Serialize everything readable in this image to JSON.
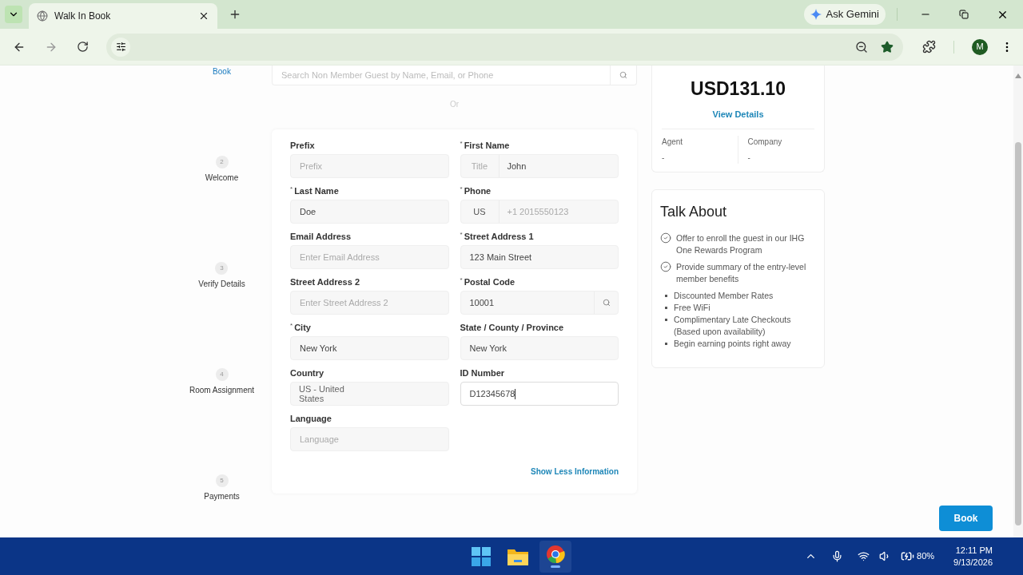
{
  "browser": {
    "tab_title": "Walk In Book",
    "ask_gemini": "Ask Gemini",
    "avatar": "M"
  },
  "steps": [
    {
      "label": "Book",
      "current": true
    },
    {
      "number": "2",
      "label": "Welcome",
      "current": false
    },
    {
      "number": "3",
      "label": "Verify Details",
      "current": false
    },
    {
      "number": "4",
      "label": "Room Assignment",
      "current": false
    },
    {
      "number": "5",
      "label": "Payments",
      "current": false
    }
  ],
  "search": {
    "placeholder": "Search Non Member Guest by Name, Email, or Phone"
  },
  "or_text": "Or",
  "fields": [
    {
      "label": "Prefix",
      "kind": "text",
      "placeholder": "Prefix",
      "focused": false
    },
    {
      "label": "First Name",
      "required_mark": "*",
      "kind": "prefixed",
      "prefix": {
        "placeholder": "Title"
      },
      "value": "John",
      "focused": false
    },
    {
      "label": "Last Name",
      "required_mark": "*",
      "kind": "text",
      "value": "Doe",
      "focused": false
    },
    {
      "label": "Phone",
      "required_mark": "*",
      "kind": "prefixed",
      "prefix": {
        "value": "US"
      },
      "placeholder": "+1 2015550123",
      "focused": false
    },
    {
      "label": "Email Address",
      "kind": "text",
      "placeholder": "Enter Email Address",
      "focused": false
    },
    {
      "label": "Street Address 1",
      "required_mark": "*",
      "kind": "text",
      "value": "123 Main Street",
      "focused": false
    },
    {
      "label": "Street Address 2",
      "kind": "text",
      "placeholder": "Enter Street Address 2",
      "focused": false
    },
    {
      "label": "Postal Code",
      "required_mark": "*",
      "kind": "search",
      "value": "10001",
      "focused": false
    },
    {
      "label": "City",
      "required_mark": "*",
      "kind": "text",
      "value": "New York",
      "focused": false
    },
    {
      "label": "State / County / Province",
      "kind": "text",
      "value": "New York",
      "focused": false
    },
    {
      "label": "Country",
      "kind": "select",
      "value": "US - United States",
      "focused": false
    },
    {
      "label": "ID Number",
      "kind": "text",
      "value": "D12345678",
      "focused": true
    },
    {
      "label": "Language",
      "kind": "text",
      "placeholder": "Language",
      "focused": false
    }
  ],
  "show_less": "Show Less Information",
  "summary": {
    "amount": "USD131.10",
    "view_details": "View Details",
    "agent": {
      "label": "Agent",
      "value": "-"
    },
    "company": {
      "label": "Company",
      "value": "-"
    }
  },
  "talk_about": {
    "title": "Talk About",
    "checklist": [
      "Offer to enroll the guest in our IHG One Rewards Program",
      "Provide summary of the entry-level member benefits"
    ],
    "bullets": [
      "Discounted Member Rates",
      "Free WiFi",
      "Complimentary Late Checkouts (Based upon availability)",
      "Begin earning points right away"
    ]
  },
  "book_button": "Book",
  "taskbar": {
    "battery": "80%",
    "time": "12:11 PM",
    "date": "9/13/2026"
  }
}
